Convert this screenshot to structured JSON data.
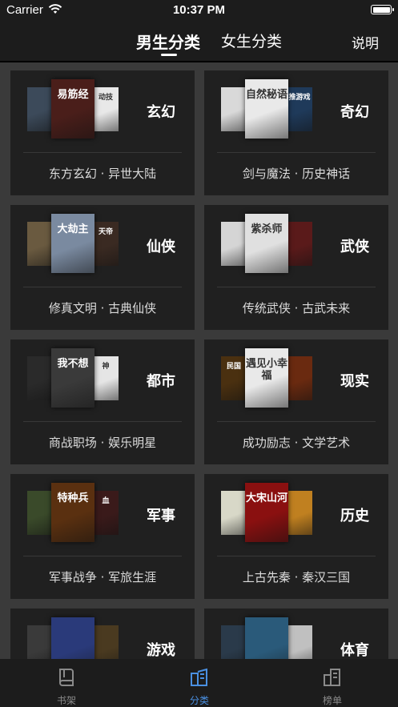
{
  "status_bar": {
    "carrier": "Carrier",
    "time": "10:37 PM",
    "battery_level": 1.0
  },
  "nav": {
    "tab_male": "男生分类",
    "tab_female": "女生分类",
    "help": "说明",
    "active_tab": "male"
  },
  "categories": [
    {
      "name": "玄幻",
      "sub": "东方玄幻 · 异世大陆",
      "covers": [
        {
          "title": "",
          "color": "#3c4a5a"
        },
        {
          "title": "易筋经",
          "color": "#4a1e1a"
        },
        {
          "title": "动技",
          "color": "#e8e8e8"
        }
      ]
    },
    {
      "name": "奇幻",
      "sub": "剑与魔法 · 历史神话",
      "covers": [
        {
          "title": "",
          "color": "#d9d9d9"
        },
        {
          "title": "自然秘语",
          "color": "#e9e9e9"
        },
        {
          "title": "推游戏",
          "color": "#1f3a5a"
        }
      ]
    },
    {
      "name": "仙侠",
      "sub": "修真文明 · 古典仙侠",
      "covers": [
        {
          "title": "",
          "color": "#6a5a40"
        },
        {
          "title": "大劫主",
          "color": "#7a8aa0"
        },
        {
          "title": "天帝",
          "color": "#3a2a22"
        }
      ]
    },
    {
      "name": "武侠",
      "sub": "传统武侠 · 古武未来",
      "covers": [
        {
          "title": "",
          "color": "#d5d5d5"
        },
        {
          "title": "紫杀师",
          "color": "#e0e0e0"
        },
        {
          "title": "",
          "color": "#5a1a1a"
        }
      ]
    },
    {
      "name": "都市",
      "sub": "商战职场 · 娱乐明星",
      "covers": [
        {
          "title": "",
          "color": "#2a2a2a"
        },
        {
          "title": "我不想",
          "color": "#3a3a3a"
        },
        {
          "title": "神",
          "color": "#e5e5e5"
        }
      ]
    },
    {
      "name": "现实",
      "sub": "成功励志 · 文学艺术",
      "covers": [
        {
          "title": "民国",
          "color": "#4a3010"
        },
        {
          "title": "遇见小幸福",
          "color": "#e9e9e9"
        },
        {
          "title": "",
          "color": "#6a2a10"
        }
      ]
    },
    {
      "name": "军事",
      "sub": "军事战争 · 军旅生涯",
      "covers": [
        {
          "title": "",
          "color": "#3a4a2a"
        },
        {
          "title": "特种兵",
          "color": "#5a3010"
        },
        {
          "title": "血",
          "color": "#3a1a1a"
        }
      ]
    },
    {
      "name": "历史",
      "sub": "上古先秦 · 秦汉三国",
      "covers": [
        {
          "title": "",
          "color": "#d8d8c8"
        },
        {
          "title": "大宋山河",
          "color": "#8a1010"
        },
        {
          "title": "",
          "color": "#c08020"
        }
      ]
    },
    {
      "name": "游戏",
      "sub": "",
      "covers": [
        {
          "title": "",
          "color": "#3a3a3a"
        },
        {
          "title": "",
          "color": "#2a3a7a"
        },
        {
          "title": "",
          "color": "#4a3a20"
        }
      ]
    },
    {
      "name": "体育",
      "sub": "",
      "covers": [
        {
          "title": "",
          "color": "#2a3a4a"
        },
        {
          "title": "",
          "color": "#2a5a7a"
        },
        {
          "title": "",
          "color": "#c0c0c0"
        }
      ]
    }
  ],
  "tab_bar": {
    "items": [
      {
        "label": "书架",
        "icon": "bookshelf-icon"
      },
      {
        "label": "分类",
        "icon": "category-icon"
      },
      {
        "label": "榜单",
        "icon": "ranking-icon"
      }
    ],
    "active": 1
  },
  "colors": {
    "accent": "#4a90e2",
    "bar_bg": "#1c1c1c",
    "card_bg": "#202020",
    "grid_bg": "#3a3a3a"
  }
}
